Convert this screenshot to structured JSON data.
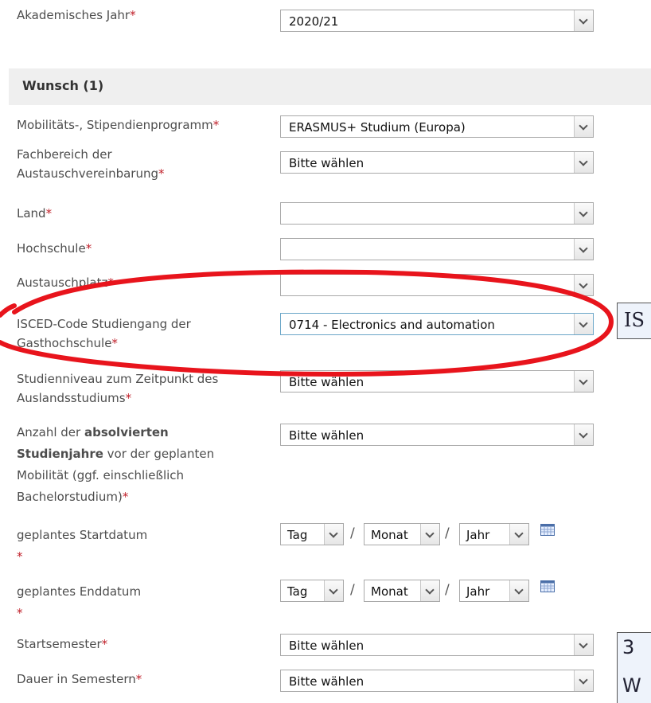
{
  "required_marker": "*",
  "academic_year": {
    "label": "Akademisches Jahr",
    "value": "2020/21"
  },
  "section": {
    "title": "Wunsch (1)"
  },
  "fields": {
    "program": {
      "label": "Mobilitäts-, Stipendienprogramm",
      "value": "ERASMUS+ Studium (Europa)"
    },
    "department": {
      "label_line1": "Fachbereich der",
      "label_line2": "Austauschvereinbarung",
      "value": "Bitte wählen"
    },
    "country": {
      "label": "Land",
      "value": ""
    },
    "university": {
      "label": "Hochschule",
      "value": ""
    },
    "exchange_place": {
      "label": "Austauschplatz",
      "value": ""
    },
    "isced": {
      "label_line1": "ISCED-Code Studiengang der",
      "label_line2": "Gasthochschule",
      "value": "0714 - Electronics and automation"
    },
    "study_level": {
      "label_line1": "Studienniveau zum Zeitpunkt des",
      "label_line2": "Auslandsstudiums",
      "value": "Bitte wählen"
    },
    "years_completed": {
      "label_pre": "Anzahl der ",
      "label_bold1": "absolvierten",
      "label_bold2": "Studienjahre",
      "label_post": " vor der geplanten",
      "label_line3": "Mobilität (ggf. einschließlich",
      "label_line4": "Bachelorstudium)",
      "value": "Bitte wählen"
    },
    "start_date": {
      "label": "geplantes Startdatum",
      "day": "Tag",
      "month": "Monat",
      "year": "Jahr"
    },
    "end_date": {
      "label": "geplantes Enddatum",
      "day": "Tag",
      "month": "Monat",
      "year": "Jahr"
    },
    "start_semester": {
      "label": "Startsemester",
      "value": "Bitte wählen"
    },
    "duration": {
      "label": "Dauer in Semestern",
      "value": "Bitte wählen"
    }
  },
  "date_separator": "/",
  "callouts": {
    "top": "IS",
    "bottom_line1": "3",
    "bottom_line2": "W"
  },
  "colors": {
    "required": "#c0202a",
    "highlight_ellipse": "#e8141c",
    "section_bg": "#efefef"
  }
}
